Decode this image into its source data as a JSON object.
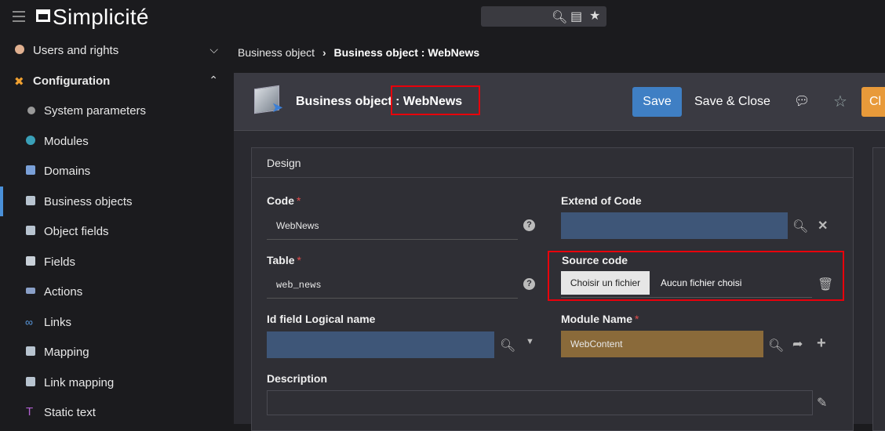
{
  "app": {
    "logo_text": "Simplicité"
  },
  "sidebar": {
    "items": [
      {
        "label": "Users and rights",
        "level": 0,
        "expanded": false
      },
      {
        "label": "Configuration",
        "level": 0,
        "expanded": true
      },
      {
        "label": "System parameters",
        "level": 1
      },
      {
        "label": "Modules",
        "level": 1
      },
      {
        "label": "Domains",
        "level": 1
      },
      {
        "label": "Business objects",
        "level": 1,
        "active": true
      },
      {
        "label": "Object fields",
        "level": 1
      },
      {
        "label": "Fields",
        "level": 1
      },
      {
        "label": "Actions",
        "level": 1
      },
      {
        "label": "Links",
        "level": 1
      },
      {
        "label": "Mapping",
        "level": 1
      },
      {
        "label": "Link mapping",
        "level": 1
      },
      {
        "label": "Static text",
        "level": 1
      }
    ]
  },
  "breadcrumb": {
    "parent": "Business object",
    "current": "Business object : WebNews"
  },
  "header": {
    "title": "Business object : WebNews",
    "save_label": "Save",
    "save_close_label": "Save & Close",
    "orange_label": "Cl"
  },
  "panel": {
    "title": "Design",
    "fields": {
      "code": {
        "label": "Code",
        "value": "WebNews",
        "required": true
      },
      "extend": {
        "label": "Extend of Code",
        "value": ""
      },
      "table": {
        "label": "Table",
        "value": "web_news",
        "required": true
      },
      "source": {
        "label": "Source code",
        "button": "Choisir un fichier",
        "status": "Aucun fichier choisi"
      },
      "idfield": {
        "label": "Id field Logical name",
        "value": ""
      },
      "module": {
        "label": "Module Name",
        "value": "WebContent",
        "required": true
      },
      "description": {
        "label": "Description",
        "value": ""
      }
    }
  },
  "colors": {
    "accent": "#3f7fc4",
    "highlight": "#e8000b",
    "orange": "#e89a3a",
    "module_bg": "#8a6a3a",
    "input_blue": "#3e5678"
  }
}
